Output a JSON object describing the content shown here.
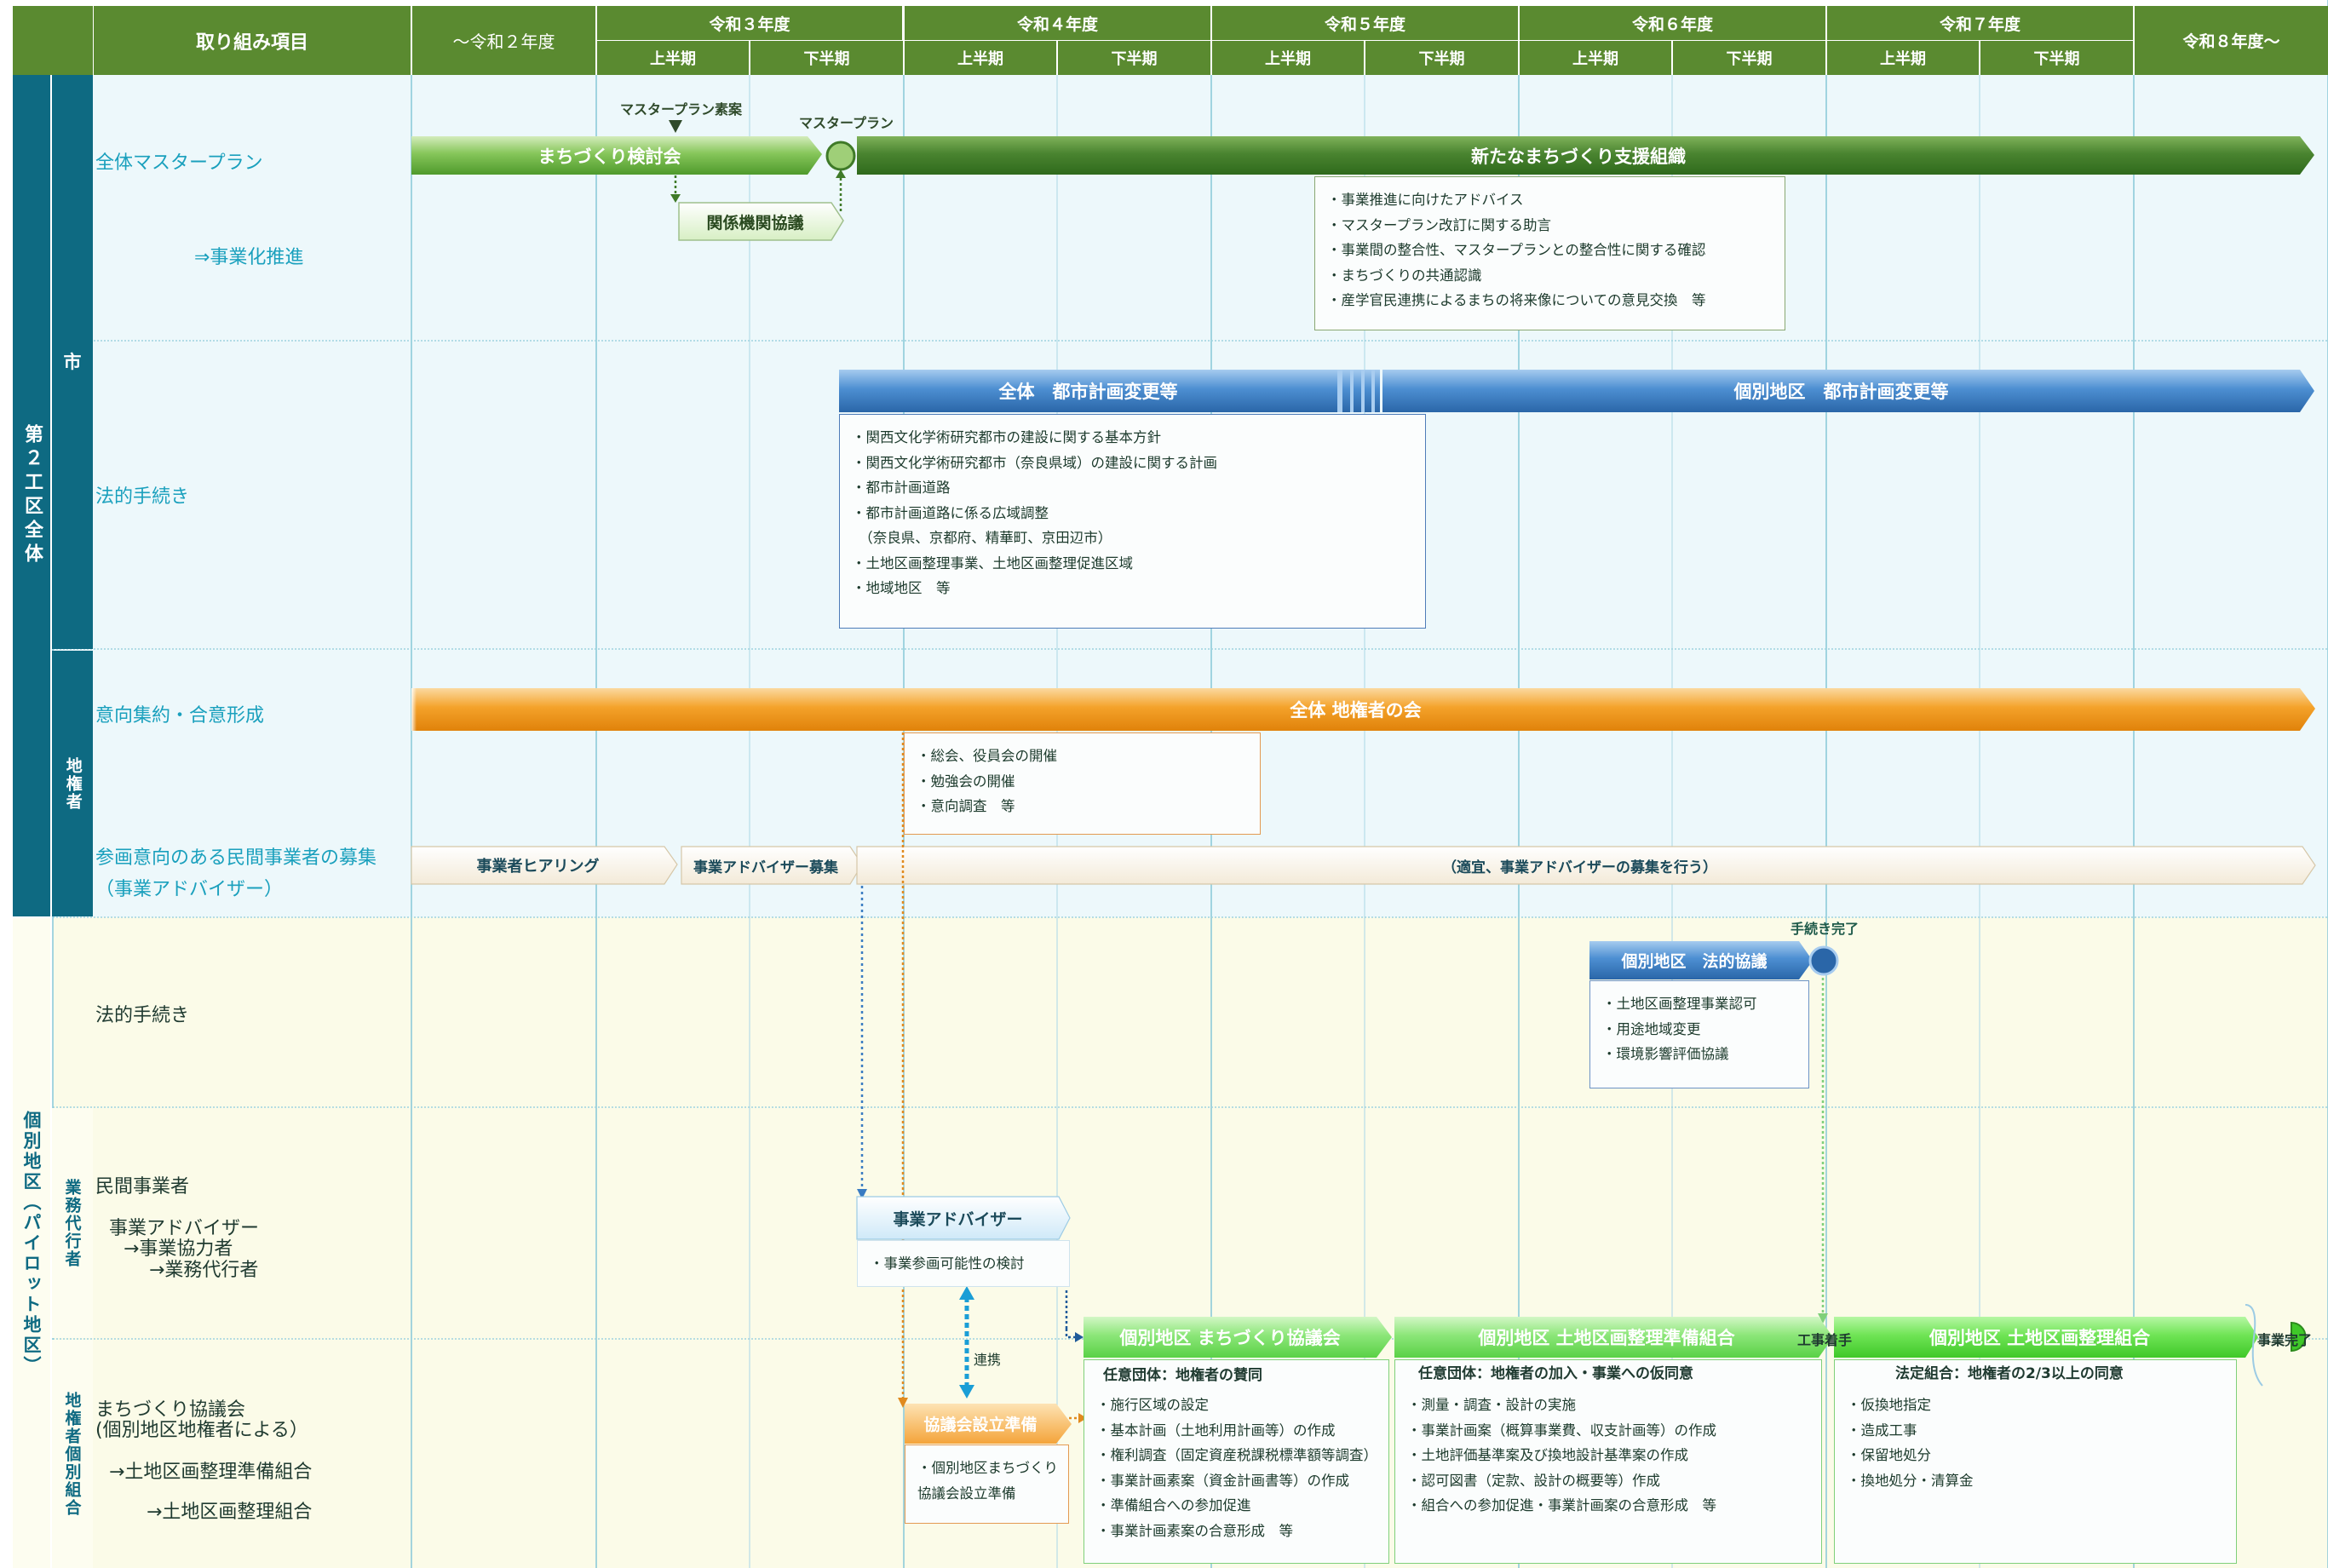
{
  "header": {
    "item_col": "取り組み項目",
    "years": [
      "～令和２年度",
      "令和３年度",
      "令和４年度",
      "令和５年度",
      "令和６年度",
      "令和７年度",
      "令和８年度～"
    ],
    "halves": [
      "上半期",
      "下半期",
      "上半期",
      "下半期",
      "上半期",
      "下半期",
      "上半期",
      "下半期",
      "上半期",
      "下半期"
    ]
  },
  "sidebar": {
    "section1": "第２工区全体",
    "section2": "個別地区（パイロット地区）",
    "sub_city": "市",
    "sub_landowners": "地権者",
    "sub_agent": "業務代行者",
    "sub_local_landowners": "地権者個別組合"
  },
  "rows": {
    "master_plan": "全体マスタープラン",
    "commercialization": "⇒事業化推進",
    "legal_procedures": "法的手続き",
    "consensus": "意向集約・合意形成",
    "recruit_line1": "参画意向のある民間事業者の募集",
    "recruit_line2": "（事業アドバイザー）",
    "local_legal": "法的手続き",
    "private_business": "民間事業者",
    "advisor_l1": "事業アドバイザー",
    "advisor_l2": "→事業協力者",
    "advisor_l3": "→業務代行者",
    "council_l1": "まちづくり協議会",
    "council_l2": "(個別地区地権者による）",
    "council_l3": "→土地区画整理準備組合",
    "council_l4": "→土地区画整理組合"
  },
  "bars": {
    "study_group": "まちづくり検討会",
    "draft_label": "マスタープラン素案",
    "mp_label": "マスタープラン",
    "related_agencies": "関係機関協議",
    "new_org": "新たなまちづくり支援組織",
    "city_plan_all": "全体　都市計画変更等",
    "city_plan_local": "個別地区　都市計画変更等",
    "landowner_assoc": "全体 地権者の会",
    "hearing": "事業者ヒアリング",
    "advisor_recruit": "事業アドバイザー募集",
    "advisor_recruit_cont": "（適宜、事業アドバイザーの募集を行う）",
    "local_legal_consult": "個別地区　法的協議",
    "proc_complete": "手続き完了",
    "advisor_box": "事業アドバイザー",
    "council_prep": "協議会設立準備",
    "renkei": "連携",
    "local_council": "個別地区 まちづくり協議会",
    "local_prep_assoc": "個別地区 土地区画整理準備組合",
    "local_assoc": "個別地区 土地区画整理組合",
    "construction_start": "工事着手",
    "project_complete": "事業完了",
    "sub_council": "任意団体：地権者の賛同",
    "sub_prep": "任意団体：地権者の加入・事業への仮同意",
    "sub_assoc": "法定組合：地権者の2/3以上の同意"
  },
  "notes": {
    "new_org": [
      "・事業推進に向けたアドバイス",
      "・マスタープラン改訂に関する助言",
      "・事業間の整合性、マスタープランとの整合性に関する確認",
      "・まちづくりの共通認識",
      "・産学官民連携によるまちの将来像についての意見交換　等"
    ],
    "city_plan": [
      "・関西文化学術研究都市の建設に関する基本方針",
      "・関西文化学術研究都市（奈良県域）の建設に関する計画",
      "・都市計画道路",
      "・都市計画道路に係る広域調整",
      "　（奈良県、京都府、精華町、京田辺市）",
      "・土地区画整理事業、土地区画整理促進区域",
      "・地域地区　等"
    ],
    "landowner": [
      "・総会、役員会の開催",
      "・勉強会の開催",
      "・意向調査　等"
    ],
    "local_legal": [
      "・土地区画整理事業認可",
      "・用途地域変更",
      "・環境影響評価協議"
    ],
    "advisor": [
      "・事業参画可能性の検討"
    ],
    "council_prep": [
      "・個別地区まちづくり",
      "協議会設立準備"
    ],
    "local_council": [
      "・施行区域の設定",
      "・基本計画（土地利用計画等）の作成",
      "・権利調査（固定資産税課税標準額等調査）",
      "・事業計画素案（資金計画書等）の作成",
      "・準備組合への参加促進",
      "・事業計画素案の合意形成　等"
    ],
    "local_prep": [
      "・測量・調査・設計の実施",
      "・事業計画案（概算事業費、収支計画等）の作成",
      "・土地評価基準案及び換地設計基準案の作成",
      "・認可図書（定款、設計の概要等）作成",
      "・組合への参加促進・事業計画案の合意形成　等"
    ],
    "local_assoc": [
      "・仮換地指定",
      "・造成工事",
      "・保留地処分",
      "・換地処分・清算金"
    ]
  },
  "colors": {
    "header_green": "#5a8a30",
    "sidebar_teal": "#0e6a82",
    "light_green_bar": "#7cc04e",
    "dark_green_bar": "#3f7a28",
    "blue_bar": "#3a7cc2",
    "orange_bar": "#f0900a",
    "bright_green_bar": "#5fe84a"
  }
}
